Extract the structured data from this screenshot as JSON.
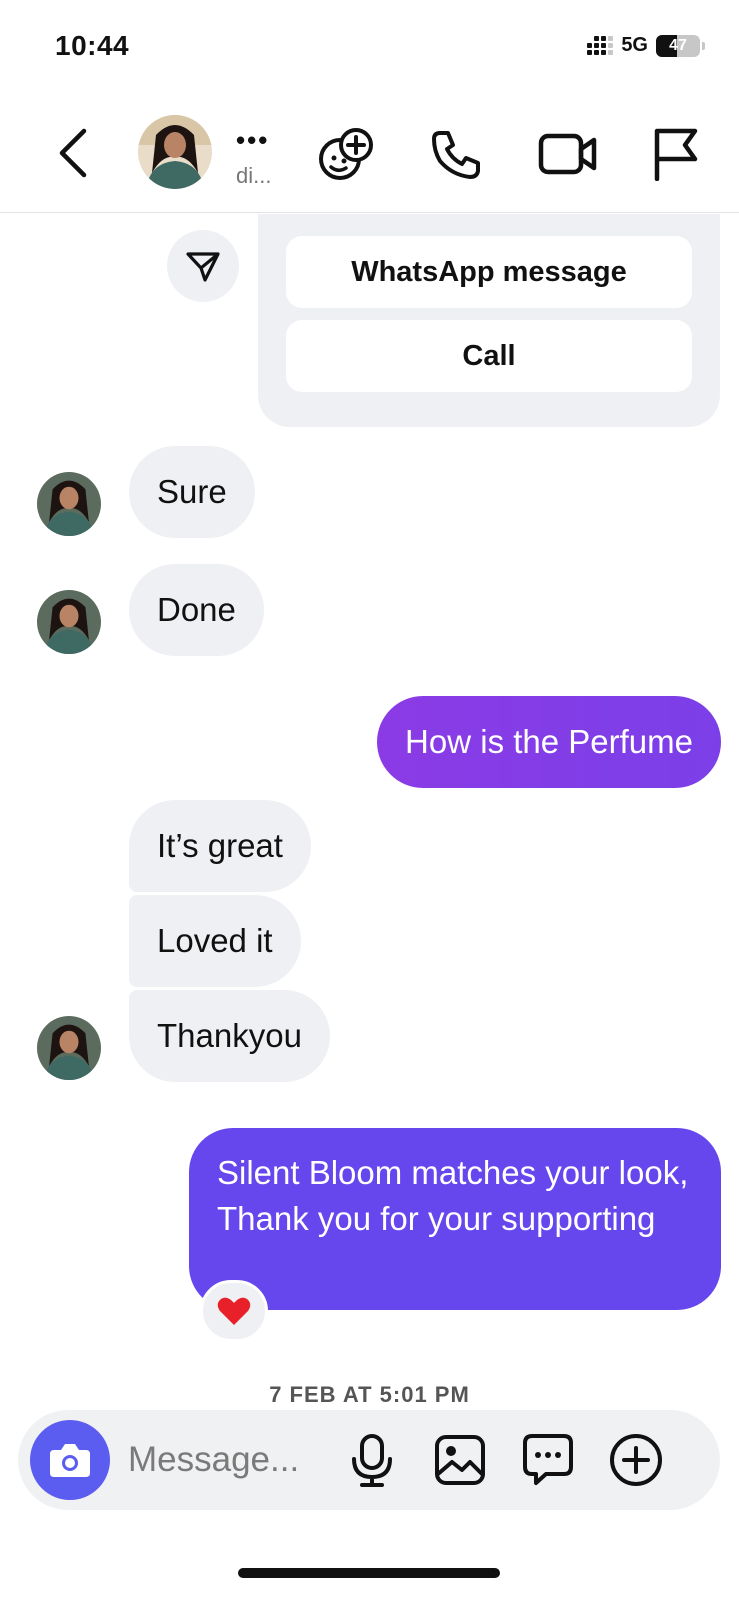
{
  "status_bar": {
    "time": "10:44",
    "network": "5G",
    "battery": "47"
  },
  "header": {
    "contact_name": "•••",
    "contact_sub": "di...",
    "icons": [
      "chevron-left-icon",
      "effects-icon",
      "phone-icon",
      "video-icon",
      "flag-icon"
    ]
  },
  "chat": {
    "card_buttons": [
      "WhatsApp message",
      "Call"
    ],
    "messages": [
      {
        "from": "them",
        "text": "Sure"
      },
      {
        "from": "them",
        "text": "Done"
      },
      {
        "from": "me",
        "text": "How is the Perfume"
      },
      {
        "from": "them",
        "text": "It’s great"
      },
      {
        "from": "them",
        "text": "Loved it"
      },
      {
        "from": "them",
        "text": "Thankyou"
      },
      {
        "from": "me",
        "text": "Silent Bloom matches your look, Thank you for your supporting",
        "reaction": "❤️"
      }
    ],
    "timestamp": "7 FEB AT 5:01 PM"
  },
  "composer": {
    "placeholder": "Message..."
  },
  "colors": {
    "incoming_bubble": "#eef0f3",
    "outgoing_purple": "#8b3be6",
    "outgoing_indigo": "#6647ee",
    "camera_button": "#5b5cf0"
  }
}
